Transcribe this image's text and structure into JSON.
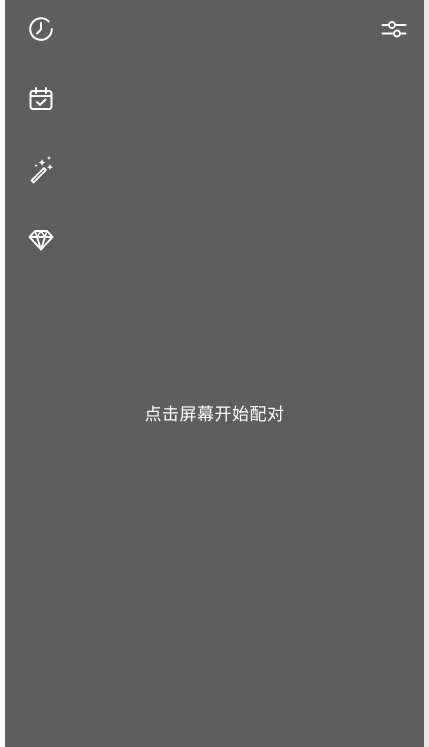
{
  "main": {
    "prompt": "点击屏幕开始配对"
  },
  "sidebar": {
    "items": [
      {
        "icon": "history-icon"
      },
      {
        "icon": "calendar-check-icon"
      },
      {
        "icon": "magic-wand-icon"
      },
      {
        "icon": "diamond-icon"
      }
    ]
  },
  "header": {
    "filter_icon": "filter-sliders-icon"
  },
  "colors": {
    "background": "#5e5e5e",
    "icon": "#ffffff",
    "text": "#ffffff"
  }
}
